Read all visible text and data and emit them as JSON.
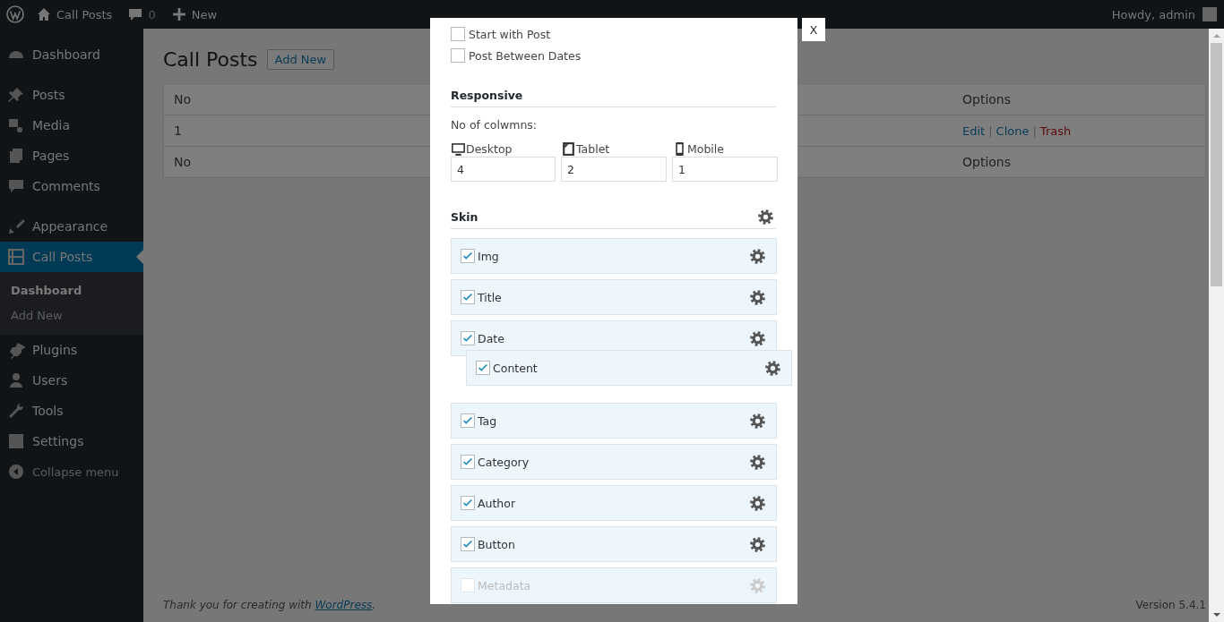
{
  "admin_bar": {
    "site": "Call Posts",
    "comments": "0",
    "new": "New",
    "greeting": "Howdy, admin"
  },
  "sidebar": {
    "groups": [
      {
        "items": [
          {
            "label": "Dashboard",
            "selected": false
          }
        ]
      },
      {
        "items": [
          {
            "label": "Posts",
            "selected": false
          },
          {
            "label": "Media",
            "selected": false
          },
          {
            "label": "Pages",
            "selected": false
          },
          {
            "label": "Comments",
            "selected": false
          }
        ]
      },
      {
        "items": [
          {
            "label": "Appearance",
            "selected": false
          },
          {
            "label": "Call Posts",
            "selected": true,
            "children": [
              {
                "label": "Dashboard",
                "selected": true
              },
              {
                "label": "Add New",
                "selected": false
              }
            ]
          },
          {
            "label": "Plugins",
            "selected": false
          },
          {
            "label": "Users",
            "selected": false
          },
          {
            "label": "Tools",
            "selected": false
          },
          {
            "label": "Settings",
            "selected": false
          }
        ]
      }
    ],
    "collapse": "Collapse menu"
  },
  "page": {
    "title": "Call Posts",
    "add_new": "Add New",
    "table": {
      "columns": [
        "No",
        "Options"
      ],
      "rows": [
        {
          "no": "1",
          "separator": "|",
          "actions": [
            {
              "label": "Edit",
              "kind": "link"
            },
            {
              "label": "Clone",
              "kind": "link"
            },
            {
              "label": "Trash",
              "kind": "delete"
            }
          ]
        }
      ],
      "footer": [
        "No",
        "Options"
      ]
    }
  },
  "footer": {
    "prefix": "Thank you for creating with ",
    "link": "WordPress",
    "suffix": ".",
    "version": "Version 5.4.1"
  },
  "modal": {
    "close": "X",
    "options": [
      {
        "label": "Start with Post",
        "checked": false
      },
      {
        "label": "Post Between Dates",
        "checked": false
      }
    ],
    "responsive": {
      "heading": "Responsive",
      "columns_label": "No of colwmns:",
      "devices": [
        {
          "label": "Desktop",
          "value": "4"
        },
        {
          "label": "Tablet",
          "value": "2"
        },
        {
          "label": "Mobile",
          "value": "1"
        }
      ]
    },
    "skin": {
      "heading": "Skin",
      "items": [
        {
          "label": "Img",
          "checked": true,
          "disabled": false,
          "dragging": false
        },
        {
          "label": "Title",
          "checked": true,
          "disabled": false,
          "dragging": false
        },
        {
          "label": "Date",
          "checked": true,
          "disabled": false,
          "dragging": false
        },
        {
          "label": "Content",
          "checked": true,
          "disabled": false,
          "dragging": true
        },
        {
          "label": "Tag",
          "checked": true,
          "disabled": false,
          "dragging": false
        },
        {
          "label": "Category",
          "checked": true,
          "disabled": false,
          "dragging": false
        },
        {
          "label": "Author",
          "checked": true,
          "disabled": false,
          "dragging": false
        },
        {
          "label": "Button",
          "checked": true,
          "disabled": false,
          "dragging": false
        },
        {
          "label": "Metadata",
          "checked": false,
          "disabled": true,
          "dragging": false
        }
      ]
    }
  }
}
